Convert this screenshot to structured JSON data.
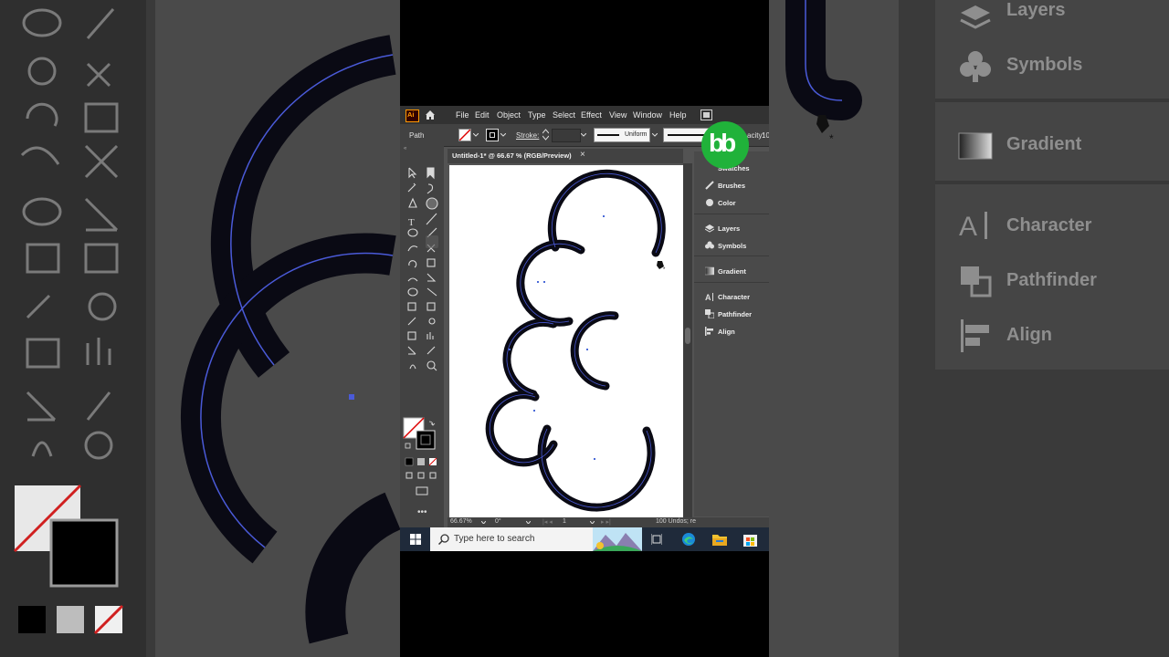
{
  "app": {
    "logo_text": "Ai",
    "menu": [
      "File",
      "Edit",
      "Object",
      "Type",
      "Select",
      "Effect",
      "View",
      "Window",
      "Help"
    ]
  },
  "control_bar": {
    "selection_label": "Path",
    "stroke_label": "Stroke:",
    "profile_label": "Uniform",
    "opacity_label": "acity:",
    "opacity_value": "10"
  },
  "document_tab": {
    "title": "Untitled-1* @ 66.67 % (RGB/Preview)",
    "close": "×"
  },
  "panels": {
    "items": [
      "Swatches",
      "Brushes",
      "Color",
      "Layers",
      "Symbols",
      "Gradient",
      "Character",
      "Pathfinder",
      "Align"
    ]
  },
  "status_bar": {
    "zoom": "66.67%",
    "rotation": "0°",
    "artboard_num": "1",
    "undo_text": "100 Undos; re"
  },
  "taskbar": {
    "search_placeholder": "Type here to search"
  },
  "background": {
    "left_labels": [],
    "right_labels": [
      "Layers",
      "Symbols",
      "Gradient",
      "Character",
      "Pathfinder",
      "Align"
    ]
  },
  "channel_logo": "bb",
  "colors": {
    "ui_dark": "#323232",
    "ui_mid": "#424242",
    "ui_panel": "#535353",
    "stroke_black": "#0a0a14",
    "path_blue": "#4a5ad8",
    "logo_green": "#20b23a"
  }
}
